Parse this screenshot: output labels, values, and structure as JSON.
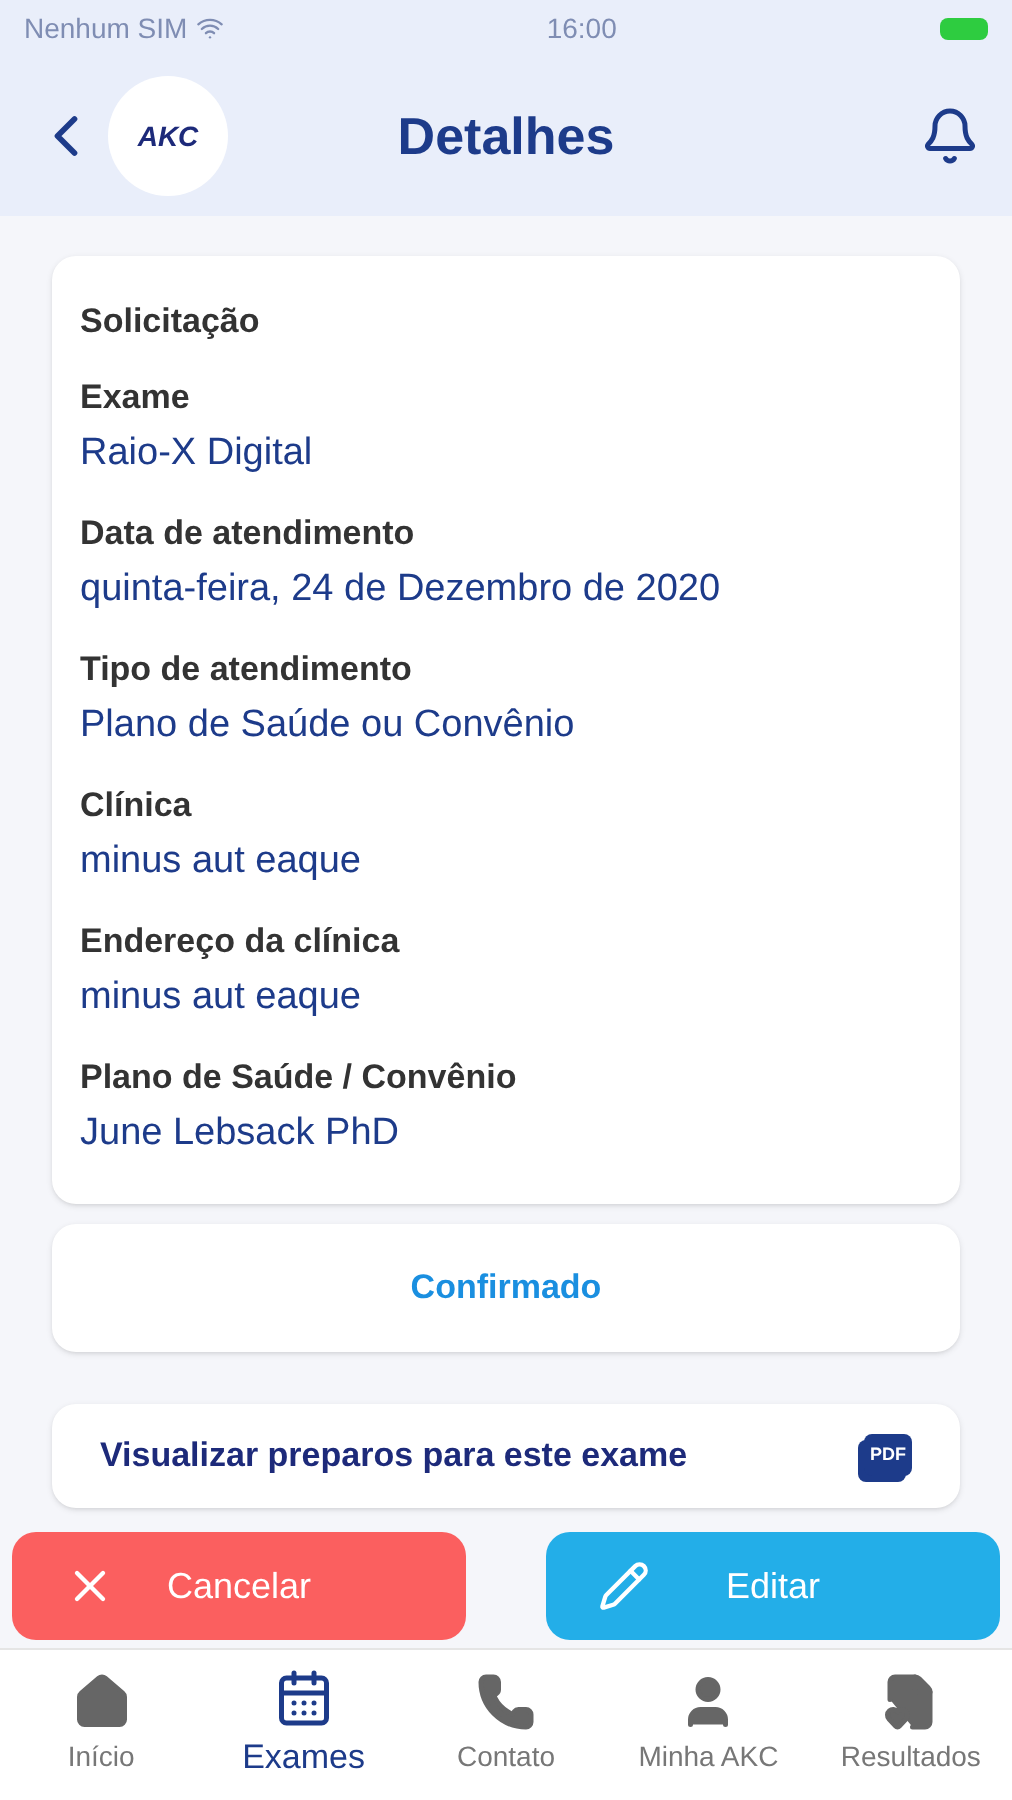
{
  "status_bar": {
    "carrier": "Nenhum SIM",
    "time": "16:00"
  },
  "header": {
    "logo_text": "AKC",
    "title": "Detalhes"
  },
  "details": {
    "heading": "Solicitação",
    "fields": [
      {
        "label": "Exame",
        "value": "Raio-X Digital"
      },
      {
        "label": "Data de atendimento",
        "value": "quinta-feira, 24 de Dezembro de 2020"
      },
      {
        "label": "Tipo de atendimento",
        "value": "Plano de Saúde ou Convênio"
      },
      {
        "label": "Clínica",
        "value": "minus aut eaque"
      },
      {
        "label": "Endereço da clínica",
        "value": "minus aut eaque"
      },
      {
        "label": "Plano de Saúde / Convênio",
        "value": "June Lebsack PhD"
      }
    ]
  },
  "status": "Confirmado",
  "preparation_link": {
    "label": "Visualizar preparos para este exame",
    "icon_text": "PDF"
  },
  "buttons": [
    {
      "kind": "cancel",
      "label": "Cancelar"
    },
    {
      "kind": "edit",
      "label": "Editar"
    }
  ],
  "tabs": [
    {
      "kind": "home",
      "label": "Início",
      "selected": false
    },
    {
      "kind": "calendar",
      "label": "Exames",
      "selected": true
    },
    {
      "kind": "phone",
      "label": "Contato",
      "selected": false
    },
    {
      "kind": "person",
      "label": "Minha AKC",
      "selected": false
    },
    {
      "kind": "results",
      "label": "Resultados",
      "selected": false
    }
  ]
}
